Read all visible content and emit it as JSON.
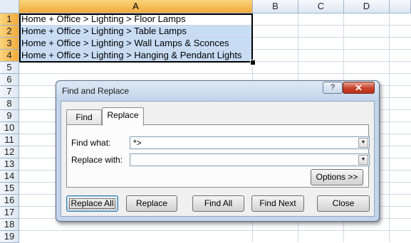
{
  "spreadsheet": {
    "columns": [
      "A",
      "B",
      "C",
      "D"
    ],
    "rows": [
      "1",
      "2",
      "3",
      "4",
      "5",
      "6",
      "7",
      "8",
      "9",
      "10",
      "11",
      "12",
      "13",
      "14",
      "15",
      "16",
      "17",
      "18",
      "19"
    ],
    "cells": [
      "Home + Office > Lighting > Floor Lamps",
      "Home + Office > Lighting > Table Lamps",
      "Home + Office > Lighting > Wall Lamps & Sconces",
      "Home + Office > Lighting > Hanging & Pendant Lights"
    ]
  },
  "dialog": {
    "title": "Find and Replace",
    "help_label": "?",
    "close_label": "✕",
    "tabs": {
      "find": "Find",
      "replace": "Replace"
    },
    "find_what_label": "Find what:",
    "find_what_value": "*>",
    "replace_with_label": "Replace with:",
    "replace_with_value": "",
    "options_label": "Options >>",
    "buttons": {
      "replace_all": "Replace All",
      "replace": "Replace",
      "find_all": "Find All",
      "find_next": "Find Next",
      "close": "Close"
    }
  },
  "colors": {
    "selection_highlight": "#c8dcf4",
    "selected_header": "#f2a93b",
    "dialog_frame": "#c4d5ea",
    "close_button": "#c7412a"
  }
}
